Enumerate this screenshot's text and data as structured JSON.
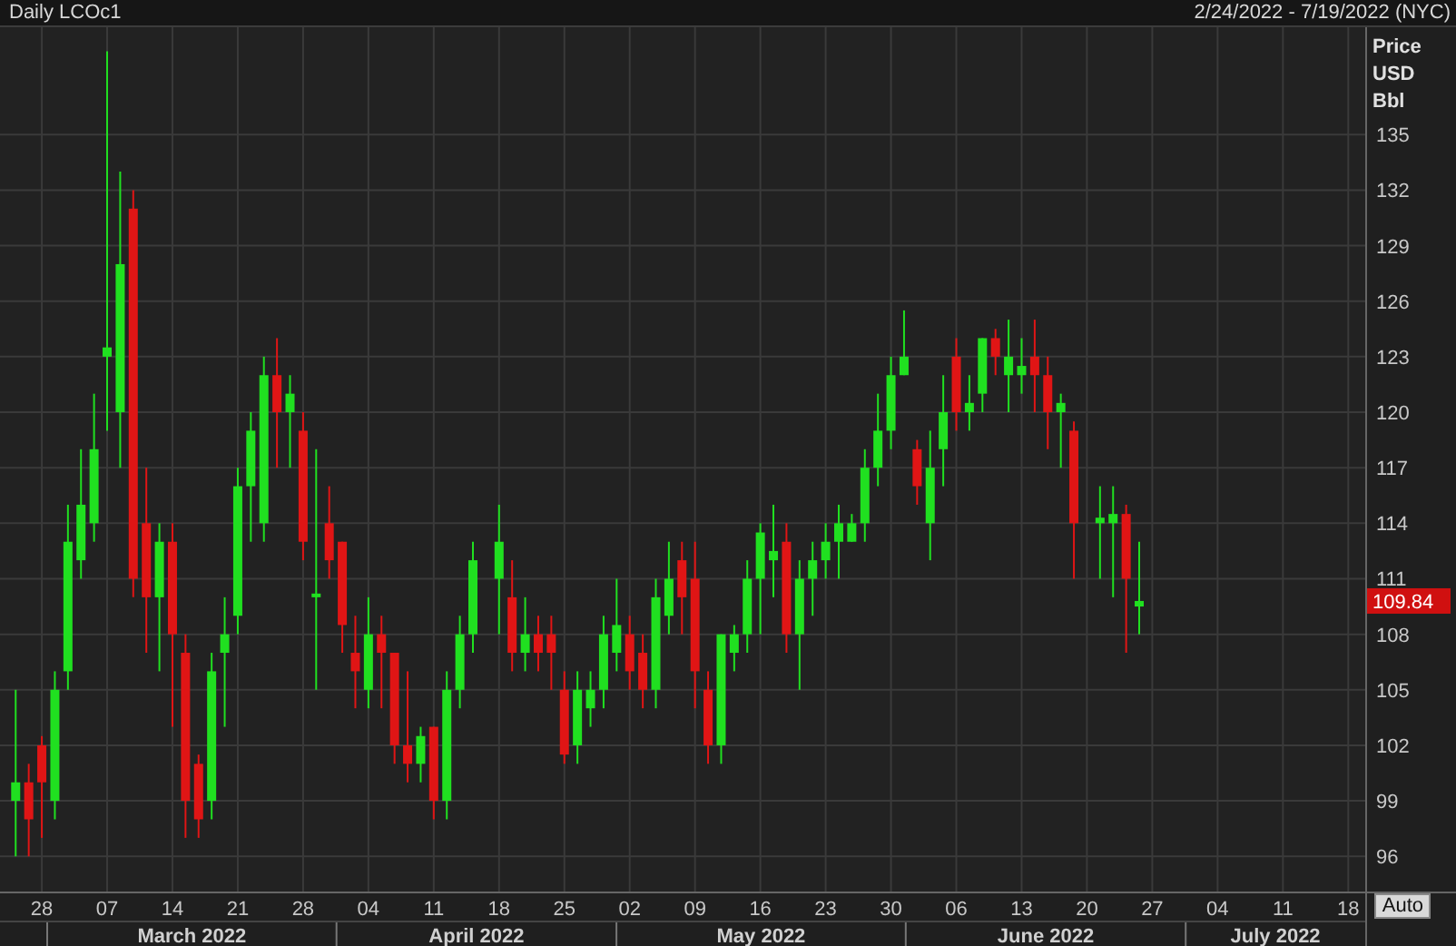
{
  "header": {
    "range": "2/24/2022 - 7/19/2022 (NYC)"
  },
  "axis_title": [
    "Price",
    "USD",
    "Bbl"
  ],
  "last_price": "109.84",
  "auto_button": "Auto",
  "month_labels": [
    "March 2022",
    "April 2022",
    "May 2022",
    "June 2022",
    "July 2022"
  ],
  "chart_data": {
    "type": "candlestick",
    "title": "Daily LCOc1",
    "categories": [
      null,
      null,
      "28",
      null,
      null,
      null,
      null,
      "07",
      null,
      null,
      null,
      null,
      "14",
      null,
      null,
      null,
      null,
      "21",
      null,
      null,
      null,
      null,
      "28",
      null,
      null,
      null,
      null,
      "04",
      null,
      null,
      null,
      null,
      "11",
      null,
      null,
      null,
      null,
      "18",
      null,
      null,
      null,
      null,
      "25",
      null,
      null,
      null,
      null,
      "02",
      null,
      null,
      null,
      null,
      "09",
      null,
      null,
      null,
      null,
      "16",
      null,
      null,
      null,
      null,
      "23",
      null,
      null,
      null,
      null,
      "30",
      null,
      null,
      null,
      null,
      "06",
      null,
      null,
      null,
      null,
      "13",
      null,
      null,
      null,
      null,
      "20",
      null,
      null,
      null,
      null,
      "27",
      null,
      null,
      null,
      null,
      "04",
      null,
      null,
      null,
      null,
      "11",
      null,
      null,
      null,
      null,
      "18"
    ],
    "ohlc": [
      [
        99,
        105,
        96,
        100
      ],
      [
        100,
        101,
        96,
        98
      ],
      [
        102,
        102.5,
        97,
        100
      ],
      [
        99,
        106,
        98,
        105
      ],
      [
        106,
        115,
        105,
        113
      ],
      [
        112,
        118,
        111,
        115
      ],
      [
        114,
        121,
        113,
        118
      ],
      [
        123,
        139.5,
        119,
        123.5
      ],
      [
        120,
        133,
        117,
        128
      ],
      [
        131,
        132,
        110,
        111
      ],
      [
        114,
        117,
        107,
        110
      ],
      [
        110,
        114,
        106,
        113
      ],
      [
        113,
        114,
        103,
        108
      ],
      [
        107,
        108,
        97,
        99
      ],
      [
        101,
        101.5,
        97,
        98
      ],
      [
        99,
        107,
        98,
        106
      ],
      [
        107,
        110,
        103,
        108
      ],
      [
        109,
        117,
        108,
        116
      ],
      [
        116,
        120,
        113,
        119
      ],
      [
        114,
        123,
        113,
        122
      ],
      [
        122,
        124,
        117,
        120
      ],
      [
        120,
        122,
        117,
        121
      ],
      [
        119,
        120,
        112,
        113
      ],
      [
        110,
        118,
        105,
        110.2
      ],
      [
        114,
        116,
        111,
        112
      ],
      [
        113,
        113,
        107,
        108.5
      ],
      [
        107,
        109,
        104,
        106
      ],
      [
        105,
        110,
        104,
        108
      ],
      [
        108,
        109,
        104,
        107
      ],
      [
        107,
        107,
        101,
        102
      ],
      [
        102,
        106,
        100,
        101
      ],
      [
        101,
        103,
        100,
        102.5
      ],
      [
        103,
        103,
        98,
        99
      ],
      [
        99,
        106,
        98,
        105
      ],
      [
        105,
        109,
        104,
        108
      ],
      [
        108,
        113,
        107,
        112
      ],
      null,
      [
        111,
        115,
        108,
        113
      ],
      [
        110,
        112,
        106,
        107
      ],
      [
        107,
        110,
        106,
        108
      ],
      [
        108,
        109,
        106,
        107
      ],
      [
        108,
        109,
        105,
        107
      ],
      [
        105,
        106,
        101,
        101.5
      ],
      [
        102,
        106,
        101,
        105
      ],
      [
        104,
        106,
        103,
        105
      ],
      [
        105,
        109,
        104,
        108
      ],
      [
        107,
        111,
        106,
        108.5
      ],
      [
        108,
        109,
        105,
        106
      ],
      [
        107,
        108,
        104,
        105
      ],
      [
        105,
        111,
        104,
        110
      ],
      [
        109,
        113,
        108,
        111
      ],
      [
        112,
        113,
        108,
        110
      ],
      [
        111,
        113,
        104,
        106
      ],
      [
        105,
        106,
        101,
        102
      ],
      [
        102,
        108,
        101,
        108
      ],
      [
        107,
        108.5,
        106,
        108
      ],
      [
        108,
        112,
        107,
        111
      ],
      [
        111,
        114,
        108,
        113.5
      ],
      [
        112,
        115,
        110,
        112.5
      ],
      [
        113,
        114,
        107,
        108
      ],
      [
        108,
        112,
        105,
        111
      ],
      [
        111,
        113,
        109,
        112
      ],
      [
        112,
        114,
        111,
        113
      ],
      [
        113,
        115,
        111,
        114
      ],
      [
        113,
        114.5,
        113,
        114
      ],
      [
        114,
        118,
        113,
        117
      ],
      [
        117,
        121,
        116,
        119
      ],
      [
        119,
        123,
        118,
        122
      ],
      [
        122,
        125.5,
        122,
        123
      ],
      [
        118,
        118.5,
        115,
        116
      ],
      [
        114,
        119,
        112,
        117
      ],
      [
        118,
        122,
        116,
        120
      ],
      [
        123,
        124,
        119,
        120
      ],
      [
        120,
        122,
        119,
        120.5
      ],
      [
        121,
        124,
        120,
        124
      ],
      [
        124,
        124.5,
        122,
        123
      ],
      [
        122,
        125,
        120,
        123
      ],
      [
        122,
        124,
        121,
        122.5
      ],
      [
        123,
        125,
        120,
        122
      ],
      [
        122,
        123,
        118,
        120
      ],
      [
        120,
        121,
        117,
        120.5
      ],
      [
        119,
        119.5,
        111,
        114
      ],
      null,
      [
        114,
        116,
        111,
        114.3
      ],
      [
        114,
        116,
        110,
        114.5
      ],
      [
        114.5,
        115,
        107,
        111
      ],
      [
        109.5,
        113,
        108,
        109.8
      ],
      null,
      null,
      null,
      null,
      null,
      null,
      null,
      null,
      null,
      null,
      null,
      null,
      null,
      null,
      null,
      null
    ],
    "grid": true,
    "ylim": [
      94.1,
      140.8
    ],
    "yticks": [
      96,
      99,
      102,
      105,
      108,
      111,
      114,
      117,
      120,
      123,
      126,
      129,
      132,
      135
    ]
  }
}
